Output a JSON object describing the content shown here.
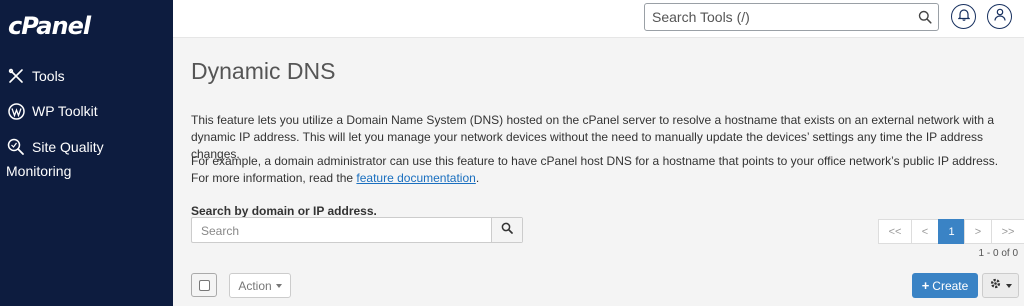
{
  "sidebar": {
    "logo": "cPanel",
    "items": [
      {
        "label": "Tools",
        "icon": "tools-icon"
      },
      {
        "label": "WP Toolkit",
        "icon": "wordpress-icon"
      },
      {
        "label": "Site Quality",
        "label2": "Monitoring",
        "icon": "site-quality-icon"
      }
    ]
  },
  "header": {
    "search_placeholder": "Search Tools (/)",
    "notifications_icon": "bell-icon",
    "user_icon": "user-icon"
  },
  "main": {
    "title": "Dynamic DNS",
    "intro": "This feature lets you utilize a Domain Name System (DNS) hosted on the cPanel server to resolve a hostname that exists on an external network with a dynamic IP address. This will let you manage your network devices without the need to manually update the devices’ settings any time the IP address changes.",
    "example_text": "For example, a domain administrator can use this feature to have cPanel host DNS for a hostname that points to your office network’s public IP address. For more information, read the ",
    "doc_link": "feature documentation",
    "example_end": ".",
    "search_label": "Search by domain or IP address.",
    "search_placeholder": "Search",
    "pagination": {
      "first": "<<",
      "prev": "<",
      "current": "1",
      "next": ">",
      "last": ">>"
    },
    "count": "1 - 0 of 0",
    "action_label": "Action",
    "create_label": "Create",
    "create_plus": "+"
  },
  "colors": {
    "sidebar_bg": "#0d1c3f",
    "accent": "#3a83c5",
    "link": "#1a6fbf"
  }
}
